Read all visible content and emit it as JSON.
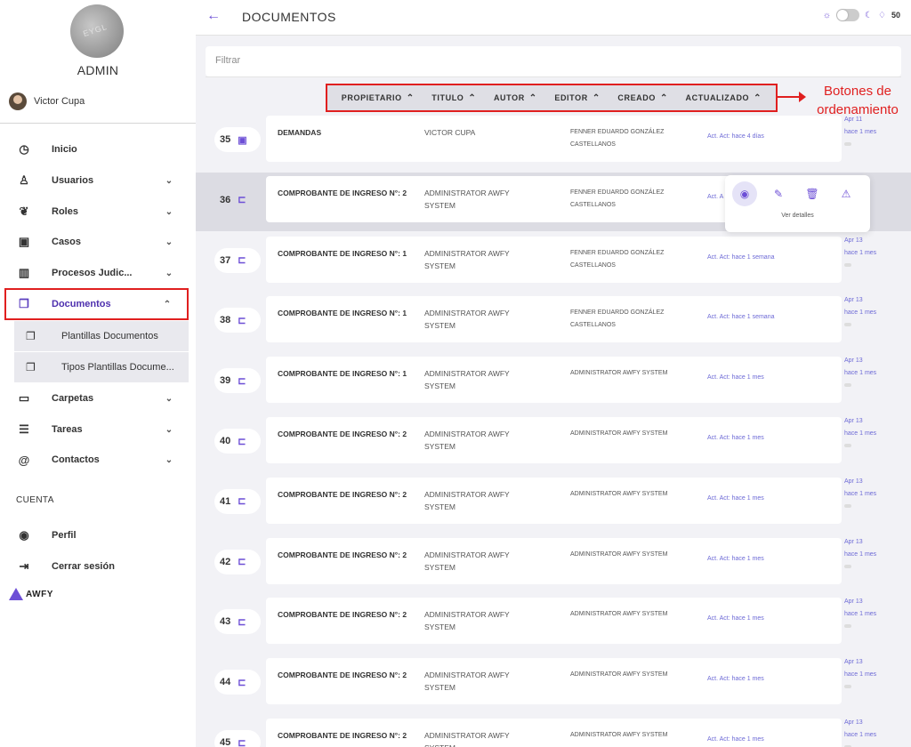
{
  "sidebar": {
    "avatar_text": "EYGL",
    "role": "ADMIN",
    "user_name": "Victor Cupa",
    "nav": [
      {
        "label": "Inicio",
        "icon": "◷",
        "chev": ""
      },
      {
        "label": "Usuarios",
        "icon": "♙",
        "chev": "⌄"
      },
      {
        "label": "Roles",
        "icon": "❦",
        "chev": "⌄"
      },
      {
        "label": "Casos",
        "icon": "▣",
        "chev": "⌄"
      },
      {
        "label": "Procesos Judic...",
        "icon": "▥",
        "chev": "⌄"
      },
      {
        "label": "Documentos",
        "icon": "❐",
        "chev": "⌃"
      },
      {
        "label": "Carpetas",
        "icon": "▭",
        "chev": "⌄"
      },
      {
        "label": "Tareas",
        "icon": "☰",
        "chev": "⌄"
      },
      {
        "label": "Contactos",
        "icon": "@",
        "chev": "⌄"
      }
    ],
    "sub": [
      {
        "label": "Plantillas Documentos",
        "icon": "❐"
      },
      {
        "label": "Tipos Plantillas Docume...",
        "icon": "❐"
      }
    ],
    "section": "CUENTA",
    "account": [
      {
        "label": "Perfil",
        "icon": "◉"
      },
      {
        "label": "Cerrar sesión",
        "icon": "⇥"
      }
    ],
    "logo_text": "AWFY"
  },
  "topbar": {
    "back_icon": "←",
    "title": "DOCUMENTOS",
    "notifications": "50"
  },
  "filter": {
    "placeholder": "Filtrar"
  },
  "sort": [
    {
      "label": "PROPIETARIO",
      "arrow": "⌃"
    },
    {
      "label": "TITULO",
      "arrow": "⌃"
    },
    {
      "label": "AUTOR",
      "arrow": "⌃"
    },
    {
      "label": "EDITOR",
      "arrow": "⌃"
    },
    {
      "label": "CREADO",
      "arrow": "⌃"
    },
    {
      "label": "ACTUALIZADO",
      "arrow": "⌃"
    }
  ],
  "annotation": "Botones de ordenamiento",
  "rows": [
    {
      "num": "35",
      "icon": "▣",
      "title": "DEMANDAS",
      "author": "VICTOR CUPA",
      "editor": "FENNER EDUARDO GONZÁLEZ CASTELLANOS",
      "act": "Act. Act: hace 4 días",
      "date": "Apr 11",
      "ago": "hace 1 mes"
    },
    {
      "num": "36",
      "icon": "⊏",
      "title": "COMPROBANTE DE INGRESO N°: 2",
      "author": "ADMINISTRATOR AWFY SYSTEM",
      "editor": "FENNER EDUARDO GONZÁLEZ CASTELLANOS",
      "act": "Act. A",
      "date": "",
      "ago": "mes"
    },
    {
      "num": "37",
      "icon": "⊏",
      "title": "COMPROBANTE DE INGRESO N°: 1",
      "author": "ADMINISTRATOR AWFY SYSTEM",
      "editor": "FENNER EDUARDO GONZÁLEZ CASTELLANOS",
      "act": "Act. Act: hace 1 semana",
      "date": "Apr 13",
      "ago": "hace 1 mes"
    },
    {
      "num": "38",
      "icon": "⊏",
      "title": "COMPROBANTE DE INGRESO N°: 1",
      "author": "ADMINISTRATOR AWFY SYSTEM",
      "editor": "FENNER EDUARDO GONZÁLEZ CASTELLANOS",
      "act": "Act. Act: hace 1 semana",
      "date": "Apr 13",
      "ago": "hace 1 mes"
    },
    {
      "num": "39",
      "icon": "⊏",
      "title": "COMPROBANTE DE INGRESO N°: 1",
      "author": "ADMINISTRATOR AWFY SYSTEM",
      "editor": "ADMINISTRATOR AWFY SYSTEM",
      "act": "Act. Act: hace 1 mes",
      "date": "Apr 13",
      "ago": "hace 1 mes"
    },
    {
      "num": "40",
      "icon": "⊏",
      "title": "COMPROBANTE DE INGRESO N°: 2",
      "author": "ADMINISTRATOR AWFY SYSTEM",
      "editor": "ADMINISTRATOR AWFY SYSTEM",
      "act": "Act. Act: hace 1 mes",
      "date": "Apr 13",
      "ago": "hace 1 mes"
    },
    {
      "num": "41",
      "icon": "⊏",
      "title": "COMPROBANTE DE INGRESO N°: 2",
      "author": "ADMINISTRATOR AWFY SYSTEM",
      "editor": "ADMINISTRATOR AWFY SYSTEM",
      "act": "Act. Act: hace 1 mes",
      "date": "Apr 13",
      "ago": "hace 1 mes"
    },
    {
      "num": "42",
      "icon": "⊏",
      "title": "COMPROBANTE DE INGRESO N°: 2",
      "author": "ADMINISTRATOR AWFY SYSTEM",
      "editor": "ADMINISTRATOR AWFY SYSTEM",
      "act": "Act. Act: hace 1 mes",
      "date": "Apr 13",
      "ago": "hace 1 mes"
    },
    {
      "num": "43",
      "icon": "⊏",
      "title": "COMPROBANTE DE INGRESO N°: 2",
      "author": "ADMINISTRATOR AWFY SYSTEM",
      "editor": "ADMINISTRATOR AWFY SYSTEM",
      "act": "Act. Act: hace 1 mes",
      "date": "Apr 13",
      "ago": "hace 1 mes"
    },
    {
      "num": "44",
      "icon": "⊏",
      "title": "COMPROBANTE DE INGRESO N°: 2",
      "author": "ADMINISTRATOR AWFY SYSTEM",
      "editor": "ADMINISTRATOR AWFY SYSTEM",
      "act": "Act. Act: hace 1 mes",
      "date": "Apr 13",
      "ago": "hace 1 mes"
    },
    {
      "num": "45",
      "icon": "⊏",
      "title": "COMPROBANTE DE INGRESO N°: 2",
      "author": "ADMINISTRATOR AWFY SYSTEM",
      "editor": "ADMINISTRATOR AWFY SYSTEM",
      "act": "Act. Act: hace 1 mes",
      "date": "Apr 13",
      "ago": "hace 1 mes"
    }
  ],
  "popover": {
    "label": "Ver detalles",
    "icons": [
      "eye-icon",
      "edit-icon",
      "trash-icon",
      "warning-icon"
    ]
  },
  "colors": {
    "accent": "#6d4fd6",
    "highlight": "#e01f1f"
  }
}
